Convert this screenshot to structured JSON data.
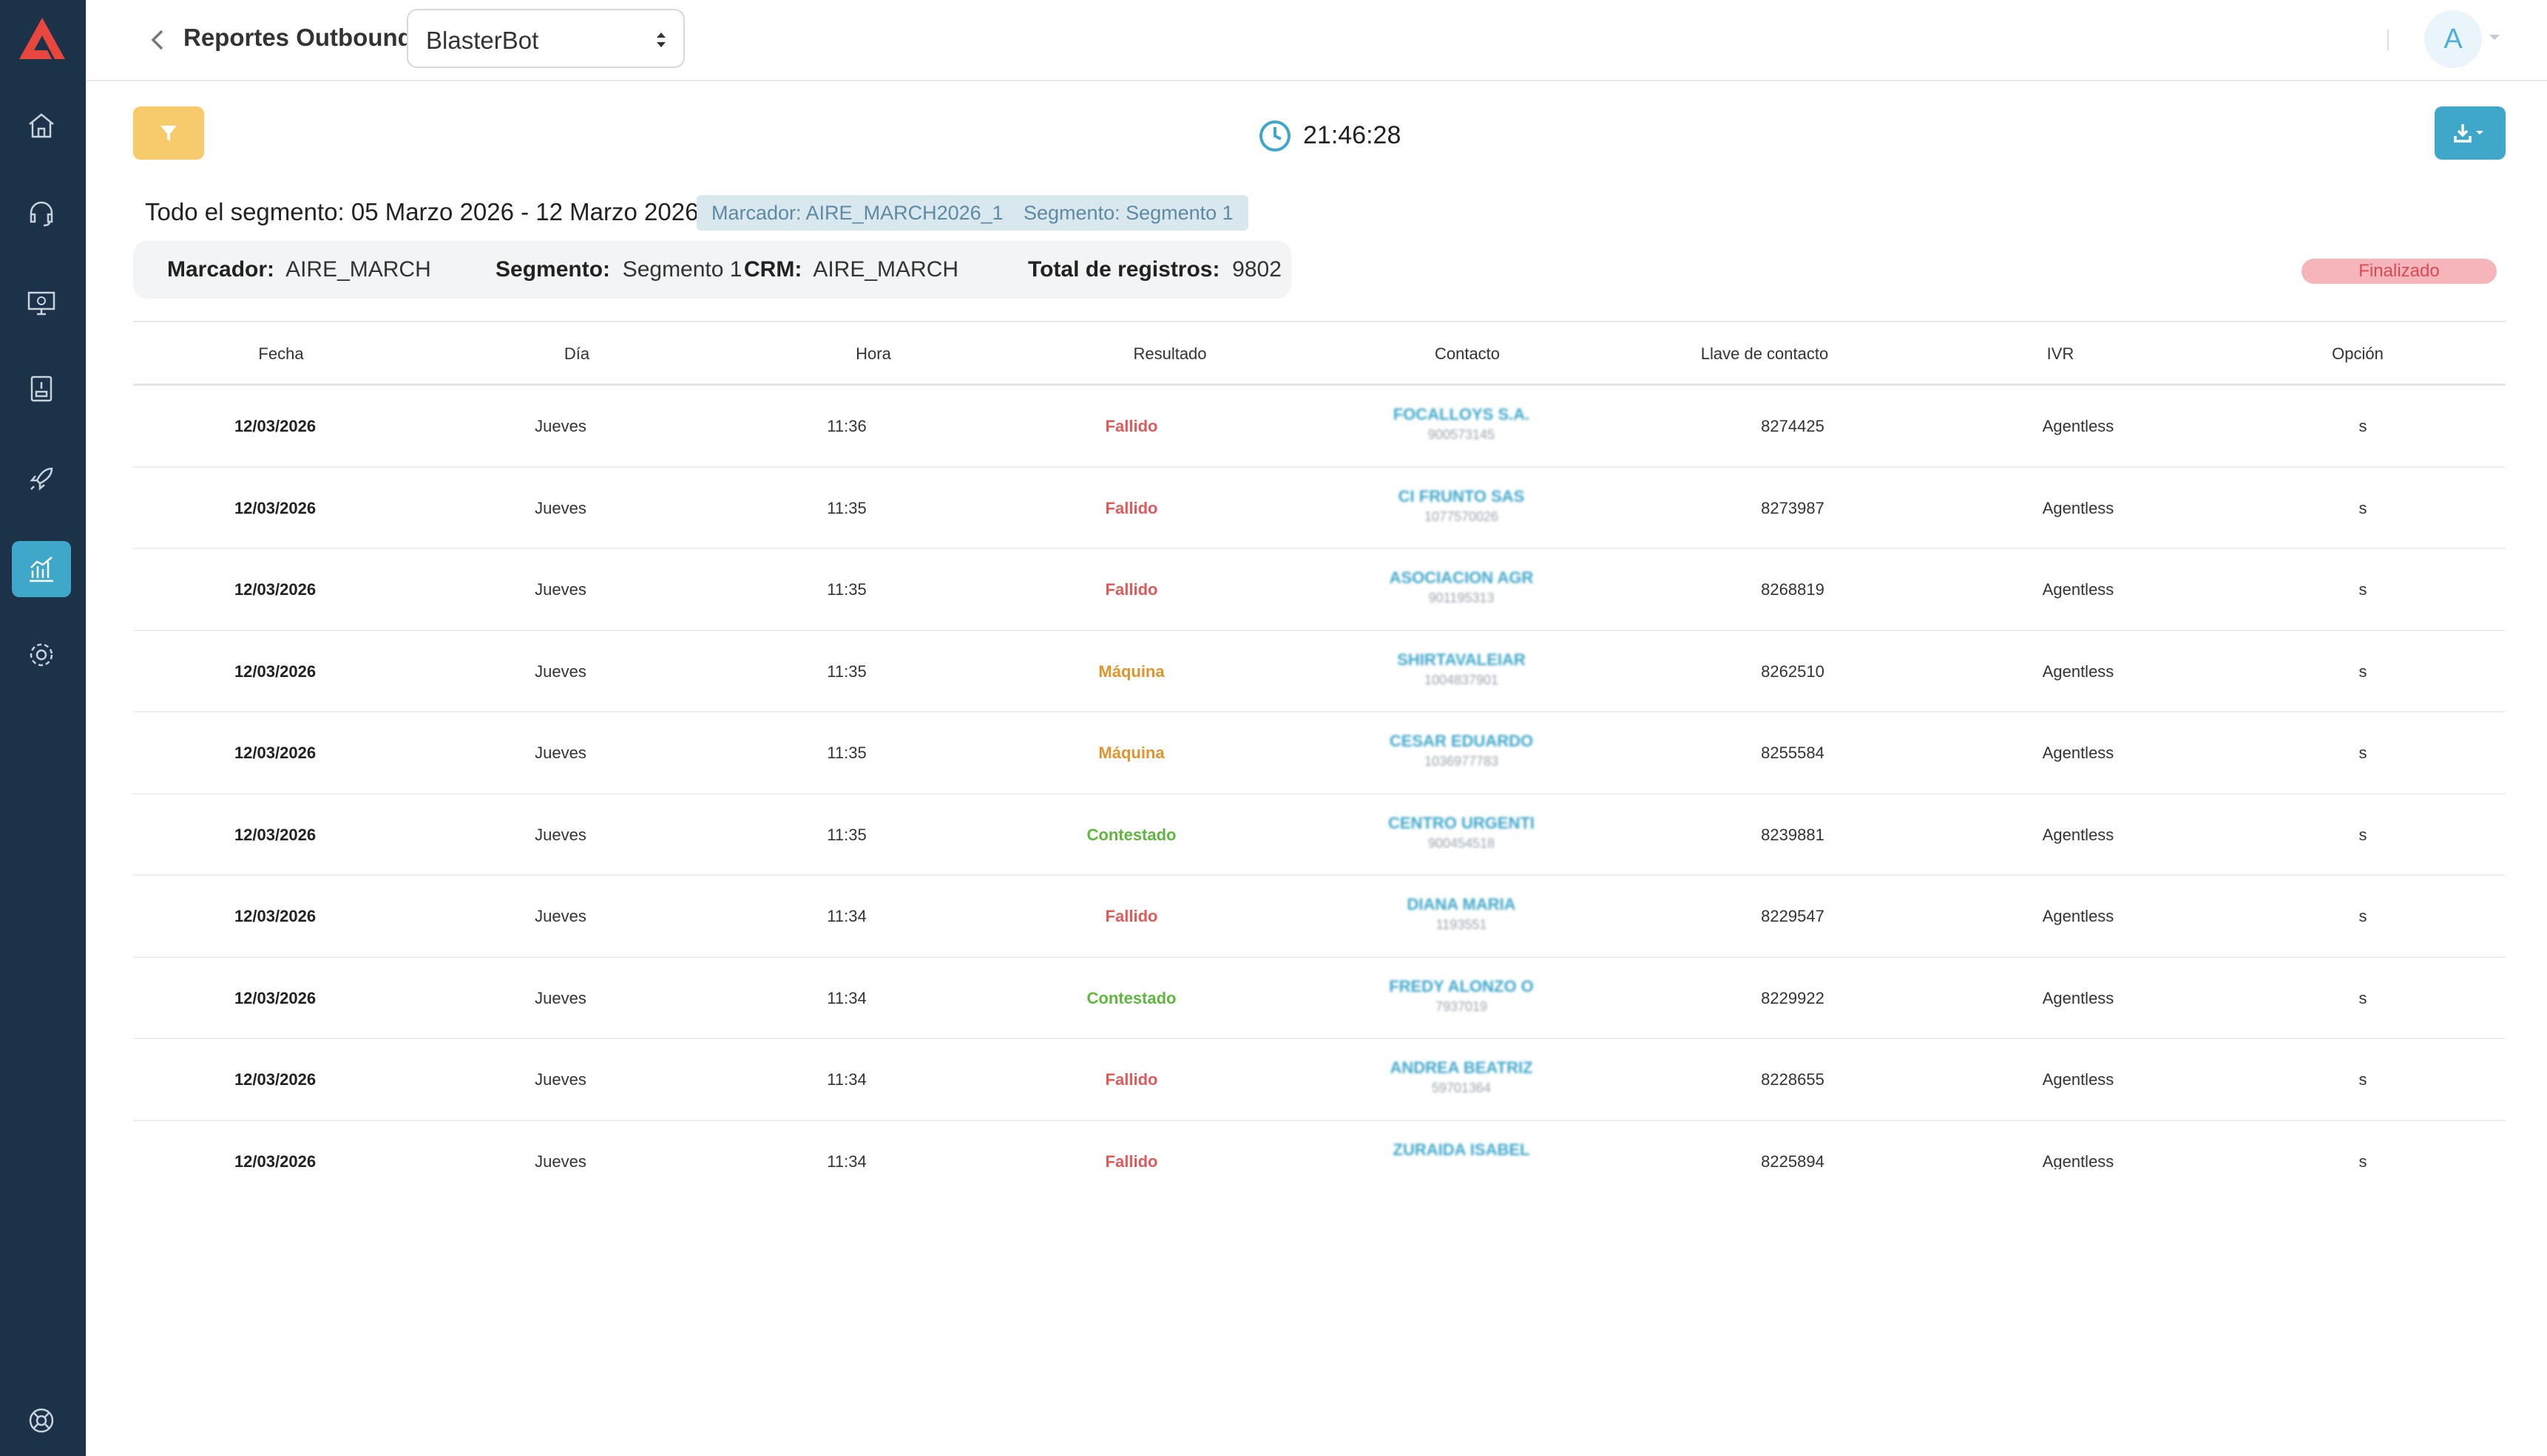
{
  "header": {
    "title": "Reportes Outbound:",
    "select_value": "BlasterBot",
    "avatar_letter": "A"
  },
  "colors": {
    "sidebar": "#1b3249",
    "accent": "#3fa7c9",
    "filter_button": "#f7cb6b",
    "fallido": "#e05a5a",
    "maquina": "#e0942e",
    "contestado": "#5fb73f"
  },
  "sidebar": {
    "items": [
      {
        "icon": "home-icon"
      },
      {
        "icon": "headset-icon"
      },
      {
        "icon": "monitor-icon"
      },
      {
        "icon": "inbox-icon"
      },
      {
        "icon": "rocket-icon"
      },
      {
        "icon": "chart-icon",
        "active": true
      },
      {
        "icon": "gear-icon"
      },
      {
        "icon": "help-icon"
      }
    ]
  },
  "toolbar": {
    "clock_time": "21:46:28"
  },
  "segment": {
    "title": "Todo el segmento: 05 Marzo 2026 - 12 Marzo 2026",
    "chip_marcador": "Marcador: AIRE_MARCH2026_1",
    "chip_segmento": "Segmento: Segmento 1"
  },
  "summary": {
    "marcador_label": "Marcador:",
    "marcador_value": "AIRE_MARCH",
    "segmento_label": "Segmento:",
    "segmento_value": "Segmento 1",
    "crm_label": "CRM:",
    "crm_value": "AIRE_MARCH",
    "total_label": "Total de registros:",
    "total_value": "9802",
    "status": "Finalizado"
  },
  "table": {
    "columns": [
      "Fecha",
      "Día",
      "Hora",
      "Resultado",
      "Contacto",
      "Llave de contacto",
      "IVR",
      "Opción"
    ],
    "rows": [
      {
        "fecha": "12/03/2026",
        "dia": "Jueves",
        "hora": "11:36",
        "resultado": "Fallido",
        "contacto": "FOCALLOYS S.A.",
        "contacto_id": "900573145",
        "llave": "8274425",
        "ivr": "Agentless",
        "opcion": "s"
      },
      {
        "fecha": "12/03/2026",
        "dia": "Jueves",
        "hora": "11:35",
        "resultado": "Fallido",
        "contacto": "CI FRUNTO SAS",
        "contacto_id": "1077570026",
        "llave": "8273987",
        "ivr": "Agentless",
        "opcion": "s"
      },
      {
        "fecha": "12/03/2026",
        "dia": "Jueves",
        "hora": "11:35",
        "resultado": "Fallido",
        "contacto": "ASOCIACION AGR",
        "contacto_id": "901195313",
        "llave": "8268819",
        "ivr": "Agentless",
        "opcion": "s"
      },
      {
        "fecha": "12/03/2026",
        "dia": "Jueves",
        "hora": "11:35",
        "resultado": "Máquina",
        "contacto": "SHIRTAVALEIAR",
        "contacto_id": "1004837901",
        "llave": "8262510",
        "ivr": "Agentless",
        "opcion": "s"
      },
      {
        "fecha": "12/03/2026",
        "dia": "Jueves",
        "hora": "11:35",
        "resultado": "Máquina",
        "contacto": "CESAR EDUARDO",
        "contacto_id": "1036977783",
        "llave": "8255584",
        "ivr": "Agentless",
        "opcion": "s"
      },
      {
        "fecha": "12/03/2026",
        "dia": "Jueves",
        "hora": "11:35",
        "resultado": "Contestado",
        "contacto": "CENTRO URGENTI",
        "contacto_id": "900454518",
        "llave": "8239881",
        "ivr": "Agentless",
        "opcion": "s"
      },
      {
        "fecha": "12/03/2026",
        "dia": "Jueves",
        "hora": "11:34",
        "resultado": "Fallido",
        "contacto": "DIANA MARIA",
        "contacto_id": "1193551",
        "llave": "8229547",
        "ivr": "Agentless",
        "opcion": "s"
      },
      {
        "fecha": "12/03/2026",
        "dia": "Jueves",
        "hora": "11:34",
        "resultado": "Contestado",
        "contacto": "FREDY ALONZO O",
        "contacto_id": "7937019",
        "llave": "8229922",
        "ivr": "Agentless",
        "opcion": "s"
      },
      {
        "fecha": "12/03/2026",
        "dia": "Jueves",
        "hora": "11:34",
        "resultado": "Fallido",
        "contacto": "ANDREA BEATRIZ",
        "contacto_id": "59701364",
        "llave": "8228655",
        "ivr": "Agentless",
        "opcion": "s"
      },
      {
        "fecha": "12/03/2026",
        "dia": "Jueves",
        "hora": "11:34",
        "resultado": "Fallido",
        "contacto": "ZURAIDA ISABEL",
        "contacto_id": "",
        "llave": "8225894",
        "ivr": "Agentless",
        "opcion": "s"
      }
    ]
  }
}
